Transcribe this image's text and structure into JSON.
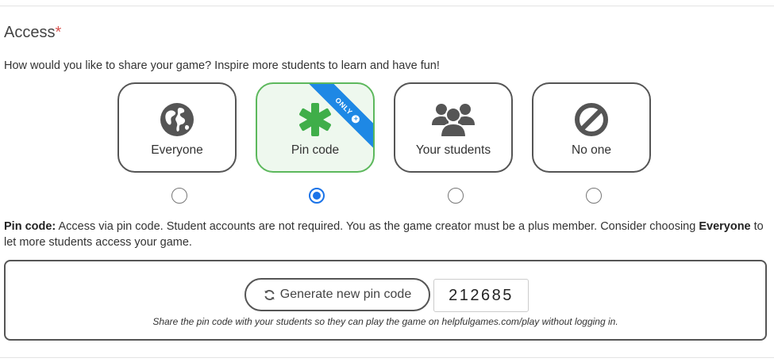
{
  "section": {
    "title": "Access",
    "required_mark": "*",
    "subtitle": "How would you like to share your game? Inspire more students to learn and have fun!"
  },
  "options": [
    {
      "label": "Everyone",
      "icon": "globe-icon",
      "selected": false
    },
    {
      "label": "Pin code",
      "icon": "asterisk-icon",
      "selected": true,
      "ribbon": "ONLY"
    },
    {
      "label": "Your students",
      "icon": "users-icon",
      "selected": false
    },
    {
      "label": "No one",
      "icon": "ban-icon",
      "selected": false
    }
  ],
  "description": {
    "lead": "Pin code:",
    "text_before": " Access via pin code. Student accounts are not required. You as the game creator must be a plus member. Consider choosing ",
    "emphasis": "Everyone",
    "text_after": " to let more students access your game."
  },
  "pin": {
    "generate_label": "Generate new pin code",
    "code": "212685",
    "note": "Share the pin code with your students so they can play the game on helpfulgames.com/play without logging in."
  },
  "colors": {
    "accent_green": "#5cb85c",
    "selected_bg": "#eef8ee",
    "ribbon_blue": "#1e88e5",
    "radio_blue": "#1a73e8",
    "required_red": "#d9534f"
  }
}
